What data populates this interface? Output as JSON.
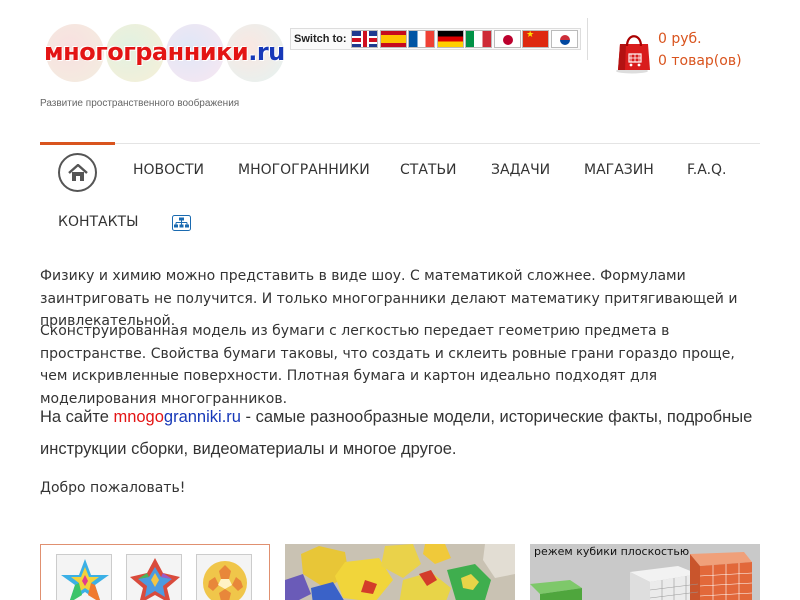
{
  "header": {
    "logo_part_red": "многогранники",
    "logo_part_blue": ".ru",
    "tagline": "Развитие пространственного воображения",
    "switch_label": "Switch to:",
    "flags": [
      "gb-flag-icon",
      "es-flag-icon",
      "fr-flag-icon",
      "de-flag-icon",
      "it-flag-icon",
      "jp-flag-icon",
      "cn-flag-icon",
      "kr-flag-icon"
    ],
    "cart": {
      "total": "0 руб.",
      "items": "0 товар(ов)",
      "icon": "shopping-bag-icon"
    }
  },
  "nav": {
    "home_icon": "home-icon",
    "items": [
      "Новости",
      "Многогранники",
      "Статьи",
      "Задачи",
      "Магазин",
      "F.A.Q.",
      "Контакты"
    ],
    "sitemap_icon": "sitemap-icon"
  },
  "content": {
    "p1": "Физику и химию можно представить в виде шоу. С математикой сложнее. Формулами заинтриговать не получится. И только многогранники делают математику притягивающей и привлекательной.",
    "p2": "Сконструированная модель из бумаги с легкостью передает геометрию предмета в пространстве. Свойства бумаги таковы, что создать и склеить ровные грани гораздо проще, чем искривленные поверхности. Плотная бумага и картон идеально подходят для моделирования многогранников.",
    "p3_prefix": "На сайте ",
    "p3_brand_red": "mnogo",
    "p3_brand_blue": "granniki.ru",
    "p3_suffix": " - самые разнообразные модели, исторические факты, подробные инструкции сборки, видеоматериалы и многое другое.",
    "welcome": "Добро пожаловать!"
  },
  "thumbnails": {
    "card3_caption": "режем кубики плоскостью"
  },
  "colors": {
    "accent": "#d9541e",
    "brand_red": "#e31414",
    "brand_blue": "#1638b8",
    "text": "#333333"
  }
}
